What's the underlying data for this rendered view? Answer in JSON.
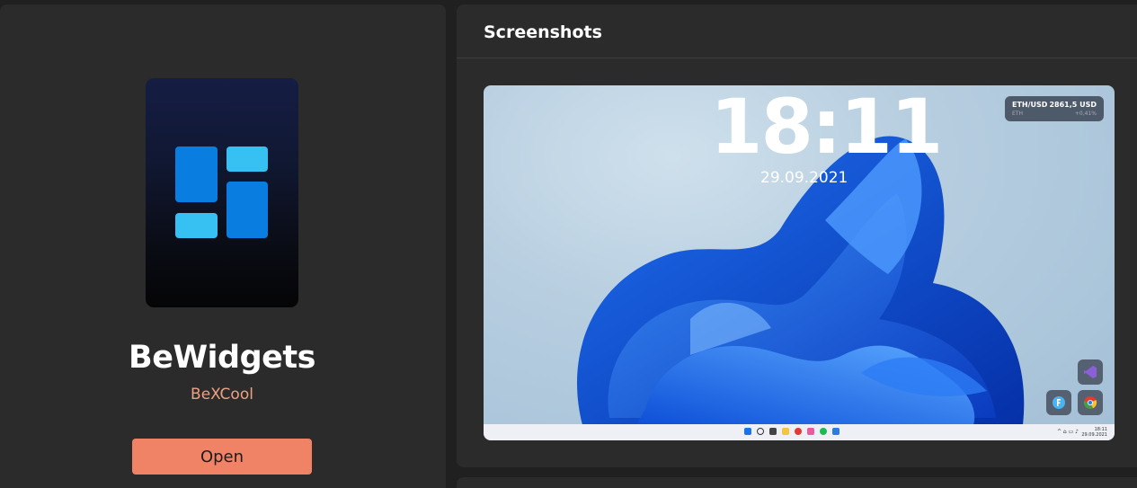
{
  "app": {
    "name": "BeWidgets",
    "author": "BeXCool",
    "open_label": "Open",
    "accent": "#f08266",
    "author_color": "#f0a082"
  },
  "screenshots": {
    "title": "Screenshots",
    "items": [
      {
        "clock": "18:11",
        "date": "29.09.2021",
        "crypto": {
          "pair": "ETH/USD",
          "coin": "ETH",
          "price": "2861,5 USD",
          "change": "+0,41%"
        },
        "tray_time": "18:11",
        "tray_date": "29.09.2021"
      }
    ]
  }
}
